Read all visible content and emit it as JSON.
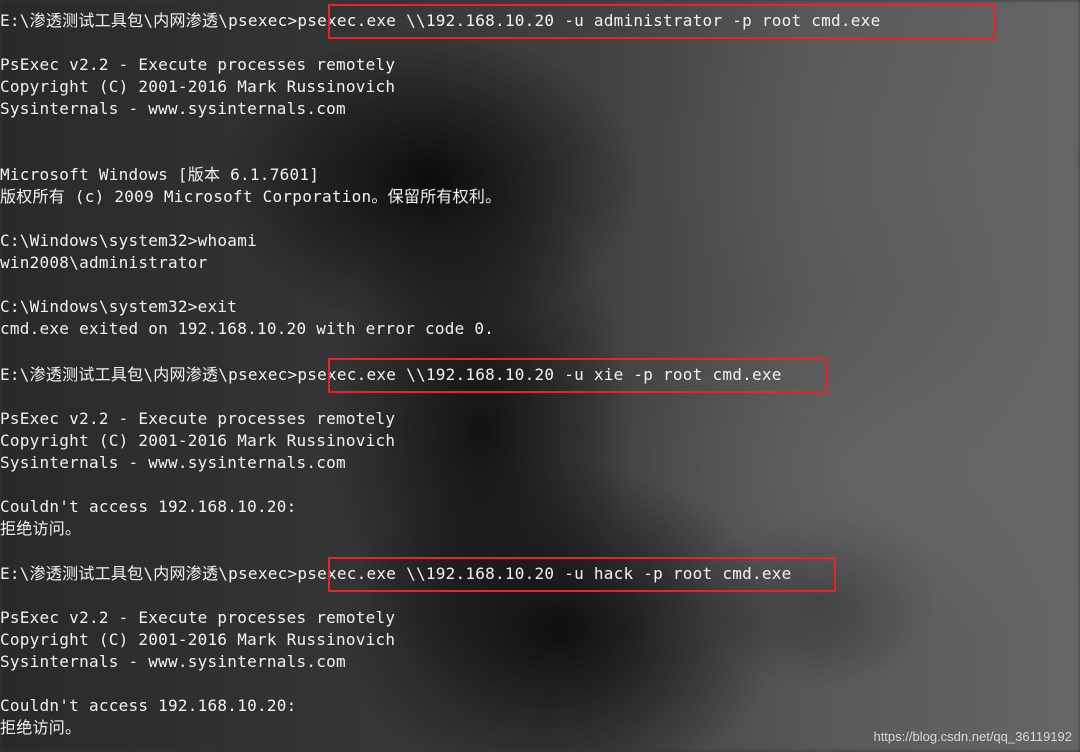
{
  "console": {
    "block1": {
      "prompt": "E:\\渗透测试工具包\\内网渗透\\psexec>",
      "command": "psexec.exe \\\\192.168.10.20 -u administrator -p root cmd.exe",
      "banner_line1": "PsExec v2.2 - Execute processes remotely",
      "banner_line2": "Copyright (C) 2001-2016 Mark Russinovich",
      "banner_line3": "Sysinternals - www.sysinternals.com",
      "os_line1": "Microsoft Windows [版本 6.1.7601]",
      "os_line2": "版权所有 (c) 2009 Microsoft Corporation。保留所有权利。",
      "cmd_whoami": "C:\\Windows\\system32>whoami",
      "whoami_result": "win2008\\administrator",
      "cmd_exit": "C:\\Windows\\system32>exit",
      "exit_message": "cmd.exe exited on 192.168.10.20 with error code 0."
    },
    "block2": {
      "prompt": "E:\\渗透测试工具包\\内网渗透\\psexec>",
      "command": "psexec.exe \\\\192.168.10.20 -u xie -p root cmd.exe",
      "banner_line1": "PsExec v2.2 - Execute processes remotely",
      "banner_line2": "Copyright (C) 2001-2016 Mark Russinovich",
      "banner_line3": "Sysinternals - www.sysinternals.com",
      "error_line1": "Couldn't access 192.168.10.20:",
      "error_line2": "拒绝访问。"
    },
    "block3": {
      "prompt": "E:\\渗透测试工具包\\内网渗透\\psexec>",
      "command": "psexec.exe \\\\192.168.10.20 -u hack -p root cmd.exe",
      "banner_line1": "PsExec v2.2 - Execute processes remotely",
      "banner_line2": "Copyright (C) 2001-2016 Mark Russinovich",
      "banner_line3": "Sysinternals - www.sysinternals.com",
      "error_line1": "Couldn't access 192.168.10.20:",
      "error_line2": "拒绝访问。"
    }
  },
  "watermark": "https://blog.csdn.net/qq_36119192",
  "colors": {
    "text": "#f2f2f2",
    "highlight_border": "#e8242b"
  }
}
